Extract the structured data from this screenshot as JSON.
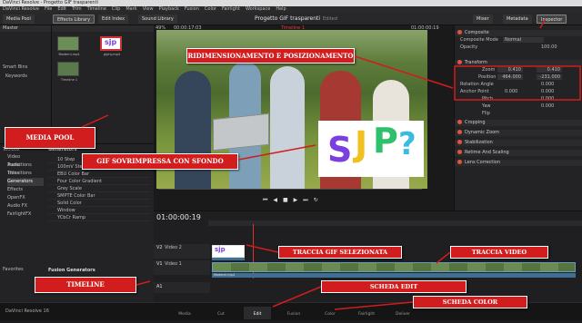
{
  "titlebar": {
    "text": "DaVinci Resolve - Progetto GIF trasparenti"
  },
  "menubar": {
    "items": [
      "DaVinci Resolve",
      "File",
      "Edit",
      "Trim",
      "Timeline",
      "Clip",
      "Mark",
      "View",
      "Playback",
      "Fusion",
      "Color",
      "Fairlight",
      "Workspace",
      "Help"
    ]
  },
  "toolbar": {
    "media_pool": "Media Pool",
    "effects_library": "Effects Library",
    "edit_index": "Edit Index",
    "sound_library": "Sound Library",
    "project_title": "Progetto GIF trasparenti",
    "project_status": "Edited",
    "mixer": "Mixer",
    "metadata": "Metadata",
    "inspector": "Inspector"
  },
  "left_panel": {
    "master": "Master",
    "smart_bins": "Smart Bins",
    "keywords": "Keywords",
    "clips": [
      {
        "name": "Moderni.mp4"
      },
      {
        "name": "giphy.mp4"
      },
      {
        "name": "Timeline 1"
      }
    ]
  },
  "viewer": {
    "zoom": "49%",
    "timecode_left": "00:00:17:03",
    "timeline_name": "Timeline 1",
    "timecode_right": "01:00:00:19"
  },
  "inspector": {
    "composite": "Composite",
    "composite_mode_label": "Composite Mode",
    "composite_mode_value": "Normal",
    "opacity_label": "Opacity",
    "opacity_value": "100.00",
    "transform": "Transform",
    "zoom_label": "Zoom",
    "zoom_x": "0.410",
    "zoom_y": "0.410",
    "position_label": "Position",
    "position_x": "464.000",
    "position_y": "-231.000",
    "rotation_label": "Rotation Angle",
    "rotation_value": "0.000",
    "anchor_label": "Anchor Point",
    "anchor_x": "0.000",
    "anchor_y": "0.000",
    "pitch_label": "Pitch",
    "pitch_value": "0.000",
    "yaw_label": "Yaw",
    "yaw_value": "0.000",
    "flip_label": "Flip",
    "cropping": "Cropping",
    "dynamic_zoom": "Dynamic Zoom",
    "stabilization": "Stabilization",
    "retime": "Retime And Scaling",
    "lens": "Lens Correction"
  },
  "effects": {
    "toolbox": "Toolbox",
    "categories": [
      "Video Transitions",
      "Audio Transitions",
      "Titles",
      "Generators",
      "Effects",
      "OpenFX",
      "Audio FX",
      "FairlightFX"
    ],
    "favorites": "Favorites",
    "generators_title": "Generators",
    "generators": [
      "10 Step",
      "100mV Steps",
      "EBU Color Bar",
      "Four Color Gradient",
      "Grey Scale",
      "SMPTE Color Bar",
      "Solid Color",
      "Window",
      "YCbCr Ramp"
    ],
    "fusion_generators": "Fusion Generators"
  },
  "timeline": {
    "timecode": "01:00:00:19",
    "v2": "V2",
    "v2_name": "Video 2",
    "v1": "V1",
    "v1_name": "Video 1",
    "a1": "A1",
    "gif_clip_label": "giphy.m...",
    "video_clip_label": "Moderni.mp4"
  },
  "pages": [
    "Media",
    "Cut",
    "Edit",
    "Fusion",
    "Color",
    "Fairlight",
    "Deliver"
  ],
  "app_name": "DaVinci Resolve 16",
  "callouts": {
    "resize": "RIDIMENSIONAMENTO E POSIZIONAMENTO",
    "media_pool": "MEDIA POOL",
    "gif": "GIF SOVRIMPRESSA CON SFONDO",
    "selected_gif": "TRACCIA GIF SELEZIONATA",
    "video_track": "TRACCIA VIDEO",
    "timeline": "TIMELINE",
    "edit_tab": "SCHEDA EDIT",
    "color_tab": "SCHEDA COLOR"
  },
  "colors": {
    "accent": "#d11d1d",
    "clip_blue": "#3f6f93",
    "playhead": "#e03030"
  }
}
